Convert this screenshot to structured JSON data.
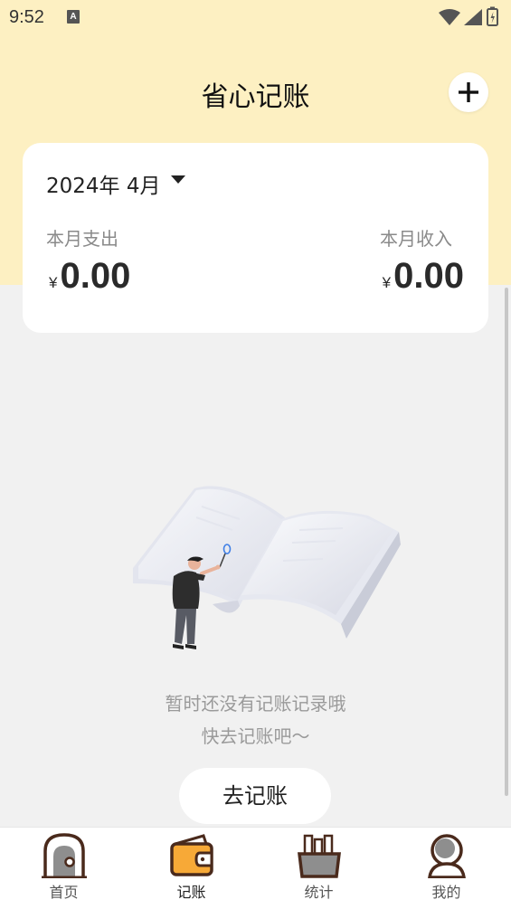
{
  "status_bar": {
    "time": "9:52",
    "notification_badge": "A"
  },
  "header": {
    "title": "省心记账",
    "add_icon": "plus-icon"
  },
  "summary_card": {
    "month": "2024年 4月",
    "expense_label": "本月支出",
    "income_label": "本月收入",
    "currency": "¥",
    "expense_amount": "0.00",
    "income_amount": "0.00"
  },
  "empty_state": {
    "line1": "暂时还没有记账记录哦",
    "line2": "快去记账吧～",
    "button_label": "去记账"
  },
  "tabs": [
    {
      "label": "首页",
      "icon": "home-icon"
    },
    {
      "label": "记账",
      "icon": "wallet-icon",
      "active": true
    },
    {
      "label": "统计",
      "icon": "stats-icon"
    },
    {
      "label": "我的",
      "icon": "profile-icon"
    }
  ],
  "colors": {
    "header_bg": "#fdf0c2",
    "accent": "#f7a937",
    "tab_outline": "#4a2a1c",
    "page_bg": "#f1f1f1"
  }
}
